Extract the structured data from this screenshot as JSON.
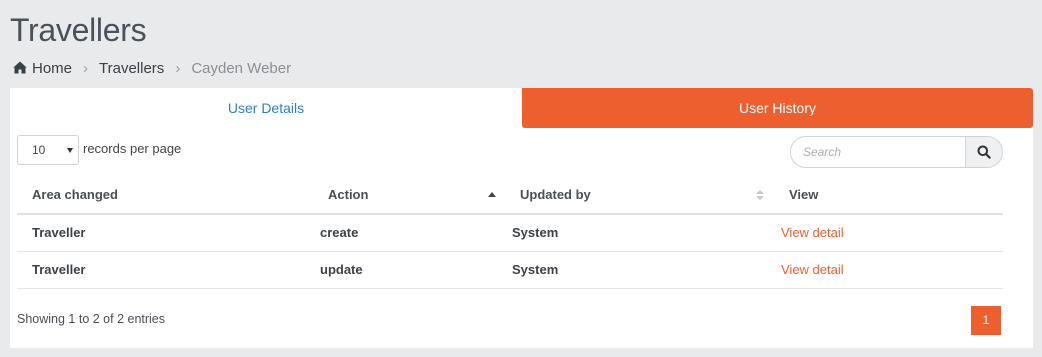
{
  "page": {
    "title": "Travellers"
  },
  "breadcrumb": {
    "home": "Home",
    "section": "Travellers",
    "current": "Cayden Weber",
    "separator": "›"
  },
  "tabs": {
    "details": "User Details",
    "history": "User History"
  },
  "length": {
    "value": "10",
    "label": "records per page"
  },
  "search": {
    "placeholder": "Search"
  },
  "table": {
    "headers": [
      "Area changed",
      "Action",
      "Updated by",
      "View"
    ],
    "rows": [
      {
        "area": "Traveller",
        "action": "create",
        "updated_by": "System",
        "view": "View detail"
      },
      {
        "area": "Traveller",
        "action": "update",
        "updated_by": "System",
        "view": "View detail"
      }
    ]
  },
  "footer": {
    "info": "Showing 1 to 2 of 2 entries",
    "page": "1"
  },
  "colors": {
    "accent": "#ee5f2f",
    "link": "#2f7fc1",
    "background": "#e9eaeb"
  },
  "icons": {
    "home": "home-icon",
    "search": "search-icon",
    "chevron": "chevron-right-icon"
  }
}
